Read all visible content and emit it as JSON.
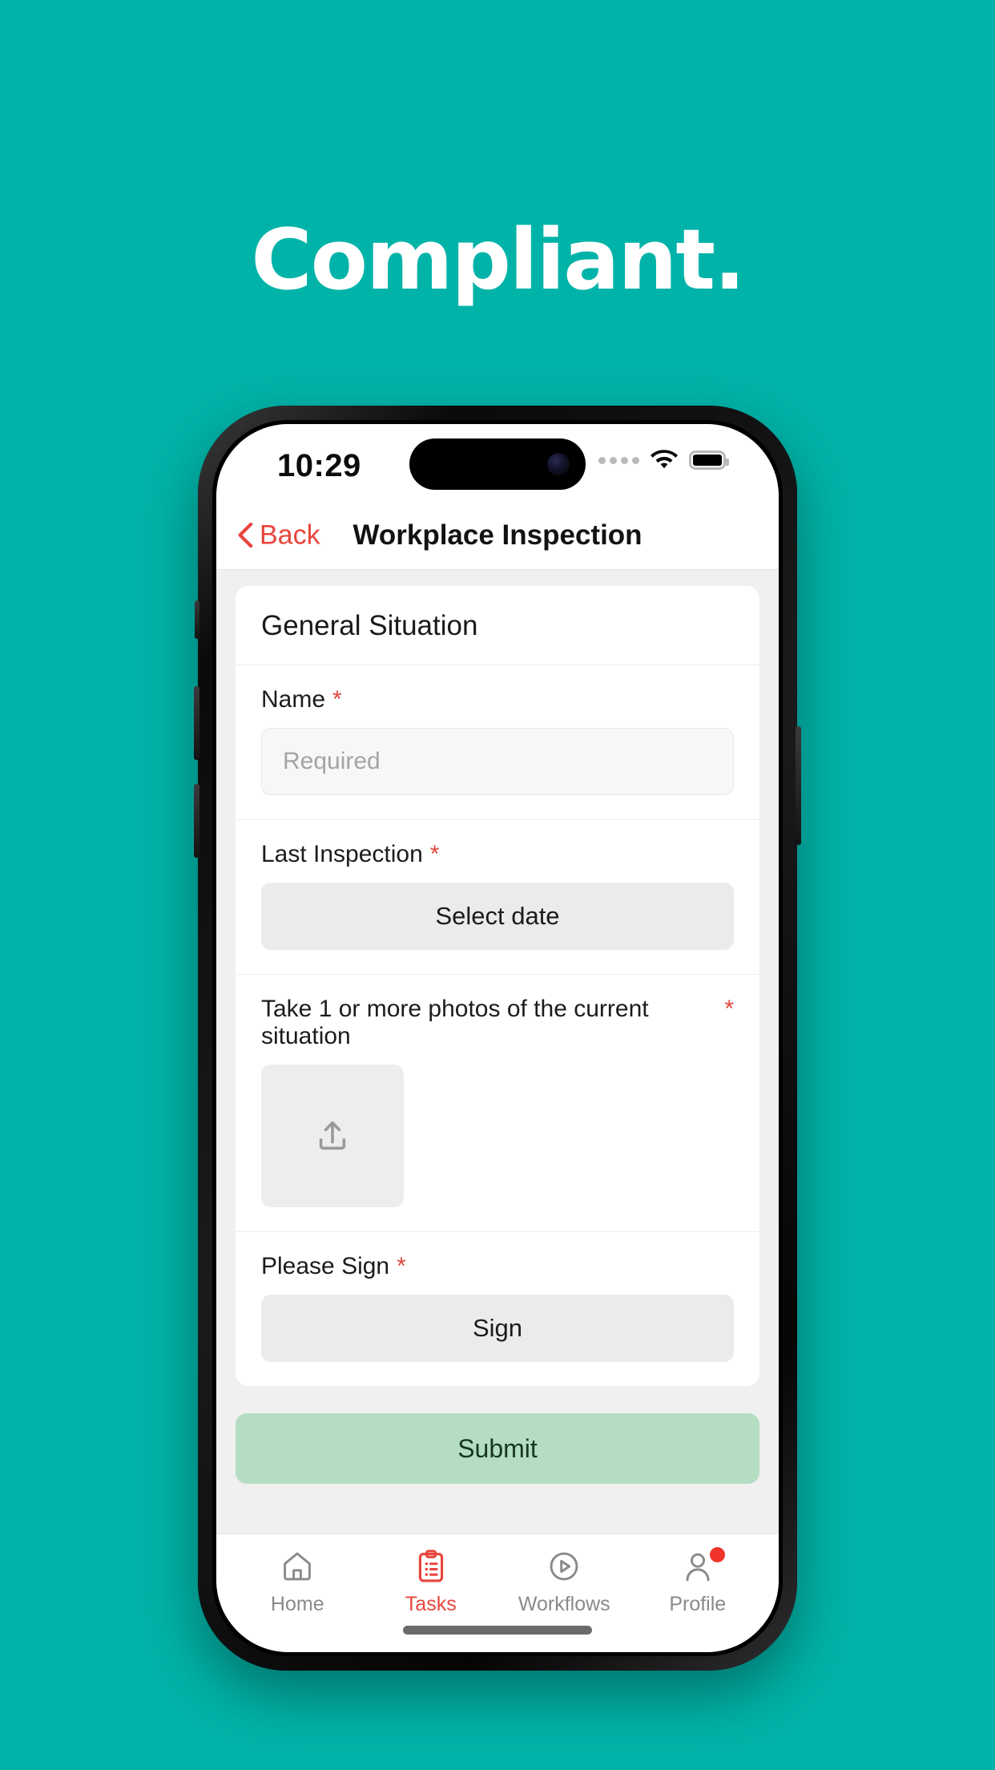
{
  "theme": {
    "background": "#00b3a8",
    "accent_red": "#e8453c",
    "submit_green": "#b5ddc2",
    "submit_text": "#18371f"
  },
  "headline": "Compliant.",
  "phone": {
    "status_bar": {
      "time": "10:29",
      "signal_icon": "signal-dots-icon",
      "wifi_icon": "wifi-icon",
      "battery_icon": "battery-full-icon"
    },
    "nav": {
      "back_label": "Back",
      "back_icon": "chevron-left-icon",
      "title": "Workplace Inspection"
    },
    "form": {
      "section_title": "General Situation",
      "fields": [
        {
          "label": "Name",
          "required_mark": "*",
          "control": "text-input",
          "placeholder": "Required",
          "value": ""
        },
        {
          "label": "Last Inspection",
          "required_mark": "*",
          "control": "date-button",
          "button_label": "Select date"
        },
        {
          "label": "Take 1 or more photos of the current situation",
          "required_mark": "*",
          "control": "photo-upload",
          "upload_icon": "upload-icon"
        },
        {
          "label": "Please Sign",
          "required_mark": "*",
          "control": "sign-button",
          "button_label": "Sign"
        }
      ],
      "submit_label": "Submit"
    },
    "tabbar": {
      "items": [
        {
          "label": "Home",
          "icon": "home-icon",
          "active": false,
          "badge": false
        },
        {
          "label": "Tasks",
          "icon": "clipboard-list-icon",
          "active": true,
          "badge": false
        },
        {
          "label": "Workflows",
          "icon": "play-circle-icon",
          "active": false,
          "badge": false
        },
        {
          "label": "Profile",
          "icon": "person-icon",
          "active": false,
          "badge": true
        }
      ]
    }
  }
}
